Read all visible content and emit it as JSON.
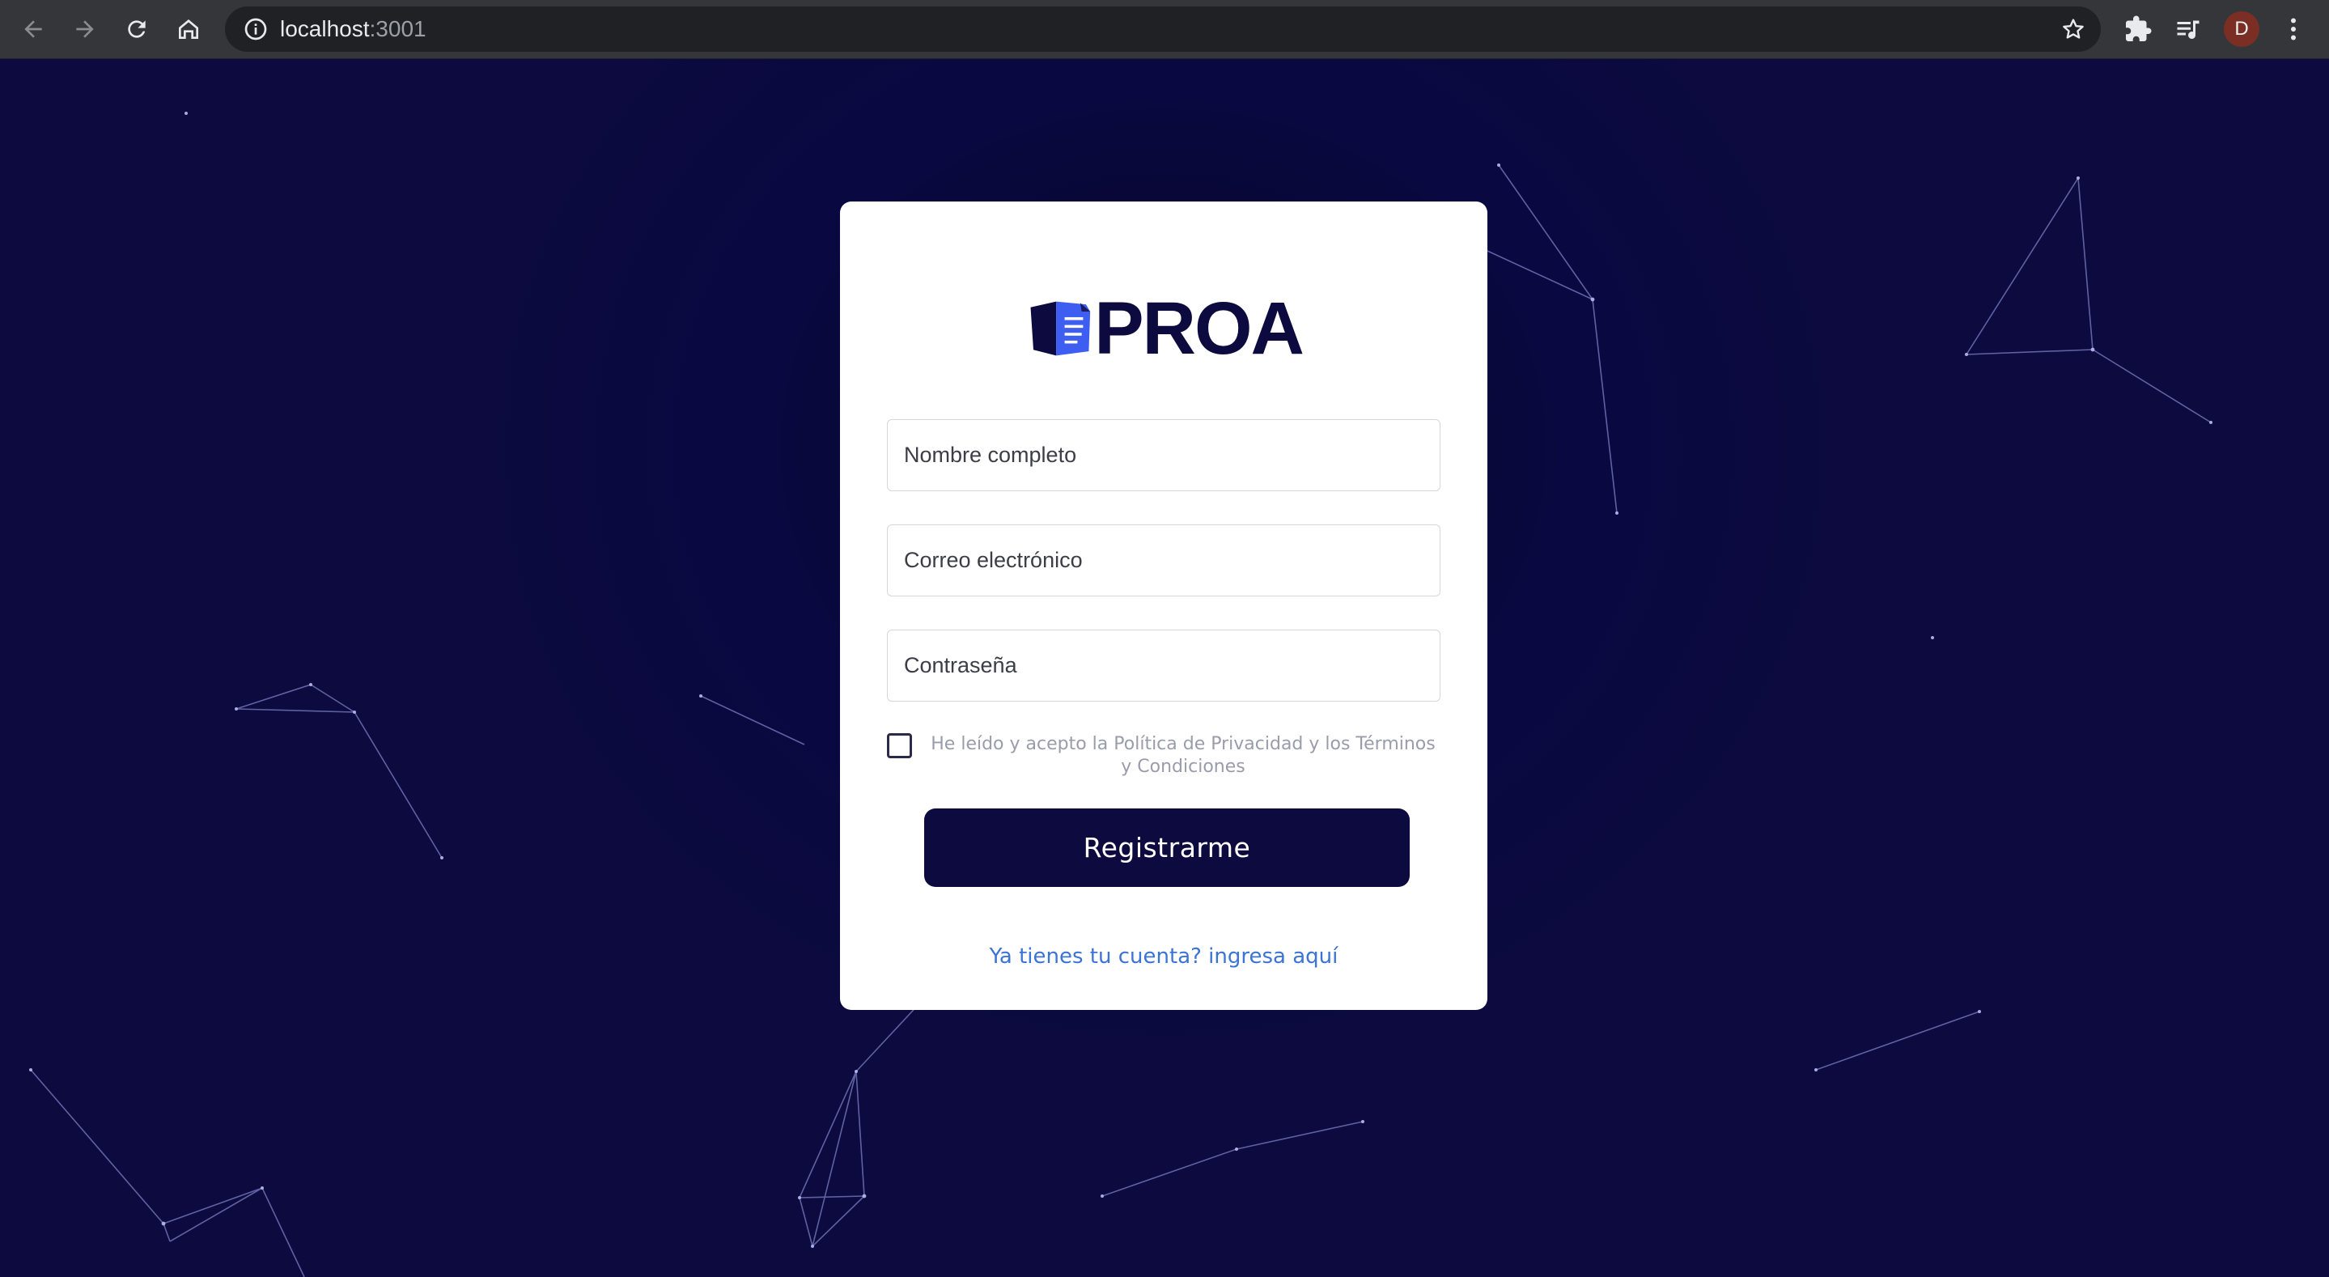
{
  "browser": {
    "url_host": "localhost",
    "url_port": ":3001",
    "profile_initial": "D",
    "icons": [
      "back-arrow-icon",
      "forward-arrow-icon",
      "reload-icon",
      "home-icon",
      "info-icon",
      "star-icon",
      "puzzle-icon",
      "playlist-icon",
      "kebab-menu-icon"
    ]
  },
  "brand": {
    "name": "PROA",
    "navy": "#0c0a3e",
    "blue": "#3d5ef0"
  },
  "form": {
    "name_placeholder": "Nombre completo",
    "email_placeholder": "Correo electrónico",
    "password_placeholder": "Contraseña",
    "terms_text": "He leído y acepto la Política de Privacidad y los Términos y Condiciones",
    "submit_label": "Registrarme",
    "login_link": "Ya tienes tu cuenta? ingresa aquí",
    "link_color": "#3b74d6"
  }
}
